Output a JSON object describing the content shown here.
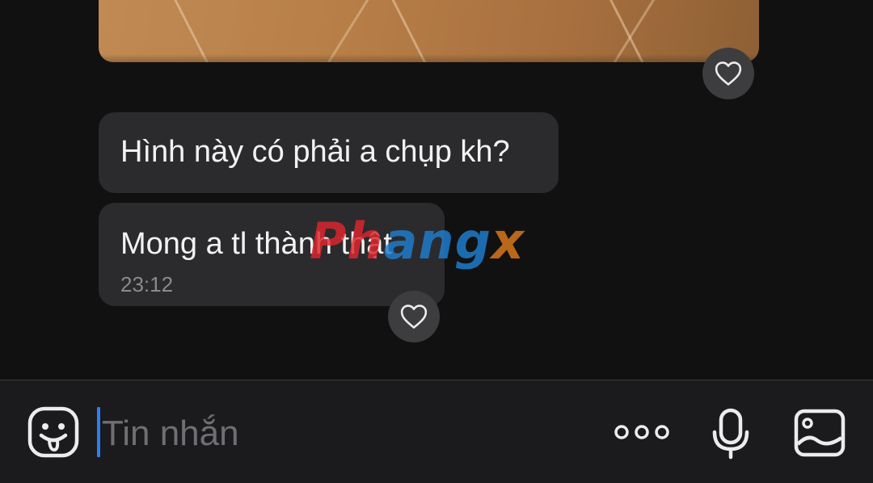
{
  "conversation": {
    "messages": [
      {
        "text": "Hình này có phải a chụp kh?"
      },
      {
        "text": "Mong a tl thành thật",
        "time": "23:12"
      }
    ]
  },
  "watermark": {
    "part1": "Ph",
    "part2": "ang",
    "part3": "x"
  },
  "composer": {
    "placeholder": "Tin nhắn"
  },
  "icons": {
    "emoji": "sticker-face-icon",
    "more": "more-dots-icon",
    "mic": "microphone-icon",
    "image": "image-gallery-icon",
    "like": "heart-icon"
  },
  "colors": {
    "background": "#111111",
    "bubble": "#2b2b2e",
    "cursor": "#2f7df6"
  }
}
